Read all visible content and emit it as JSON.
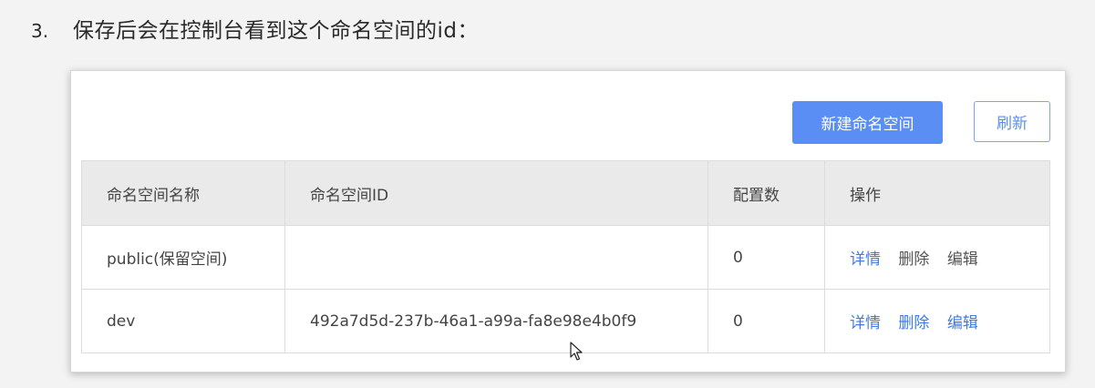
{
  "step": {
    "number": "3.",
    "text": "保存后会在控制台看到这个命名空间的id："
  },
  "toolbar": {
    "new_label": "新建命名空间",
    "refresh_label": "刷新"
  },
  "table": {
    "headers": [
      "命名空间名称",
      "命名空间ID",
      "配置数",
      "操作"
    ],
    "rows": [
      {
        "name": "public(保留空间)",
        "id": "",
        "count": "0",
        "ops": [
          "详情",
          "删除",
          "编辑"
        ]
      },
      {
        "name": "dev",
        "id": "492a7d5d-237b-46a1-a99a-fa8e98e4b0f9",
        "count": "0",
        "ops": [
          "详情",
          "删除",
          "编辑"
        ]
      }
    ]
  },
  "colors": {
    "accent": "#5b8ef5",
    "link": "#3d7be8"
  }
}
